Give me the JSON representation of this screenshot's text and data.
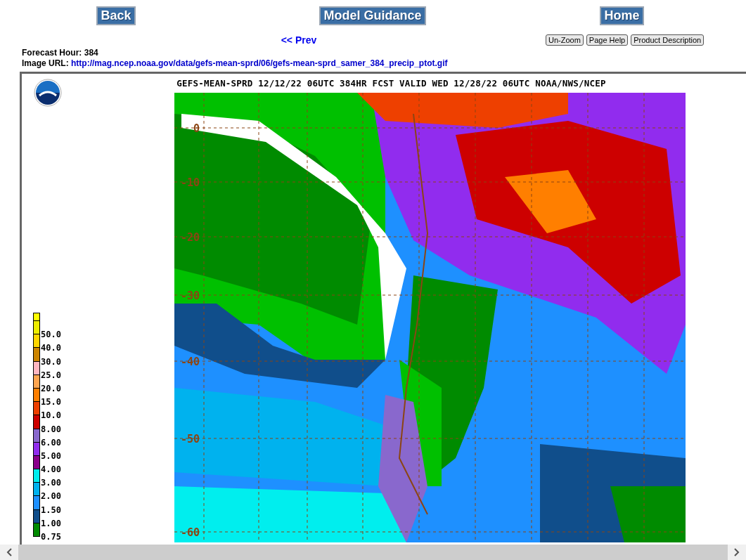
{
  "nav_buttons": [
    {
      "label": "Back"
    },
    {
      "label": "Model Guidance"
    },
    {
      "label": "Home"
    }
  ],
  "prev_link": "<< Prev",
  "tool_buttons": [
    {
      "label": "Un-Zoom"
    },
    {
      "label": "Page Help"
    },
    {
      "label": "Product Description"
    }
  ],
  "info": [
    {
      "kind": "text",
      "label": "Forecast Hour:",
      "value": "384"
    },
    {
      "kind": "link",
      "label": "Image URL:",
      "value": "http://mag.ncep.noaa.gov/data/gefs-mean-sprd/06/gefs-mean-sprd_samer_384_precip_ptot.gif"
    }
  ],
  "image": {
    "title": "GEFS-MEAN-SPRD 12/12/22 06UTC 384HR FCST VALID WED 12/28/22 06UTC NOAA/NWS/NCEP",
    "latitude_labels": [
      "0",
      "-10",
      "-20",
      "-30",
      "-40",
      "-50",
      "-60"
    ],
    "legend": {
      "top_swatch": {
        "color": "#ffff00"
      },
      "levels": [
        {
          "label": "50.0",
          "color": "#eeee00"
        },
        {
          "label": "40.0",
          "color": "#ffd700"
        },
        {
          "label": "30.0",
          "color": "#cd8500"
        },
        {
          "label": "25.0",
          "color": "#ffb6c1"
        },
        {
          "label": "20.0",
          "color": "#ffa54f"
        },
        {
          "label": "15.0",
          "color": "#ff7f00"
        },
        {
          "label": "10.0",
          "color": "#ee4000"
        },
        {
          "label": "8.00",
          "color": "#cd0000"
        },
        {
          "label": "6.00",
          "color": "#8968cd"
        },
        {
          "label": "5.00",
          "color": "#912cee"
        },
        {
          "label": "4.00",
          "color": "#8b008b"
        },
        {
          "label": "3.00",
          "color": "#00eeee"
        },
        {
          "label": "2.00",
          "color": "#00b2ee"
        },
        {
          "label": "1.50",
          "color": "#1e90ff"
        },
        {
          "label": "1.00",
          "color": "#104e8b"
        },
        {
          "label": "0.75",
          "color": "#008b00"
        }
      ]
    }
  }
}
